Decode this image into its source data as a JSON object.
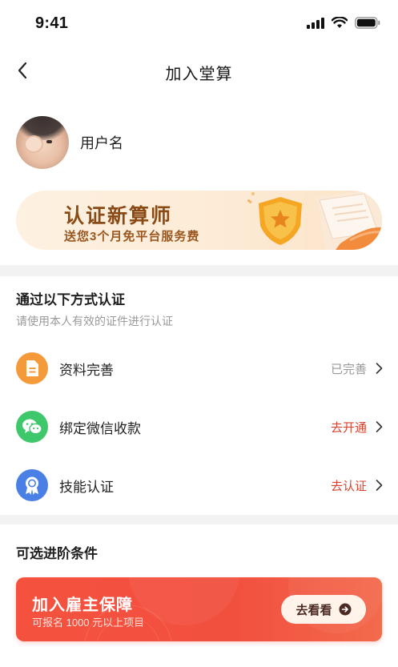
{
  "status_bar": {
    "time": "9:41"
  },
  "nav": {
    "title": "加入堂算"
  },
  "profile": {
    "username": "用户名"
  },
  "banner": {
    "title": "认证新算师",
    "subtitle": "送您3个月免平台服务费"
  },
  "verify": {
    "title": "通过以下方式认证",
    "subtitle": "请使用本人有效的证件进行认证",
    "items": [
      {
        "label": "资料完善",
        "status": "已完善",
        "icon": "document-icon",
        "icon_color": "#f59a3b",
        "status_color": "#999999"
      },
      {
        "label": "绑定微信收款",
        "status": "去开通",
        "icon": "wechat-icon",
        "icon_color": "#3fc86b",
        "status_color": "#d9432f"
      },
      {
        "label": "技能认证",
        "status": "去认证",
        "icon": "badge-icon",
        "icon_color": "#4a7fe5",
        "status_color": "#d9432f"
      }
    ]
  },
  "advanced": {
    "title": "可选进阶条件",
    "card": {
      "title": "加入雇主保障",
      "subtitle": "可报名 1000 元以上项目",
      "button_label": "去看看",
      "color": "#f5513f"
    }
  }
}
